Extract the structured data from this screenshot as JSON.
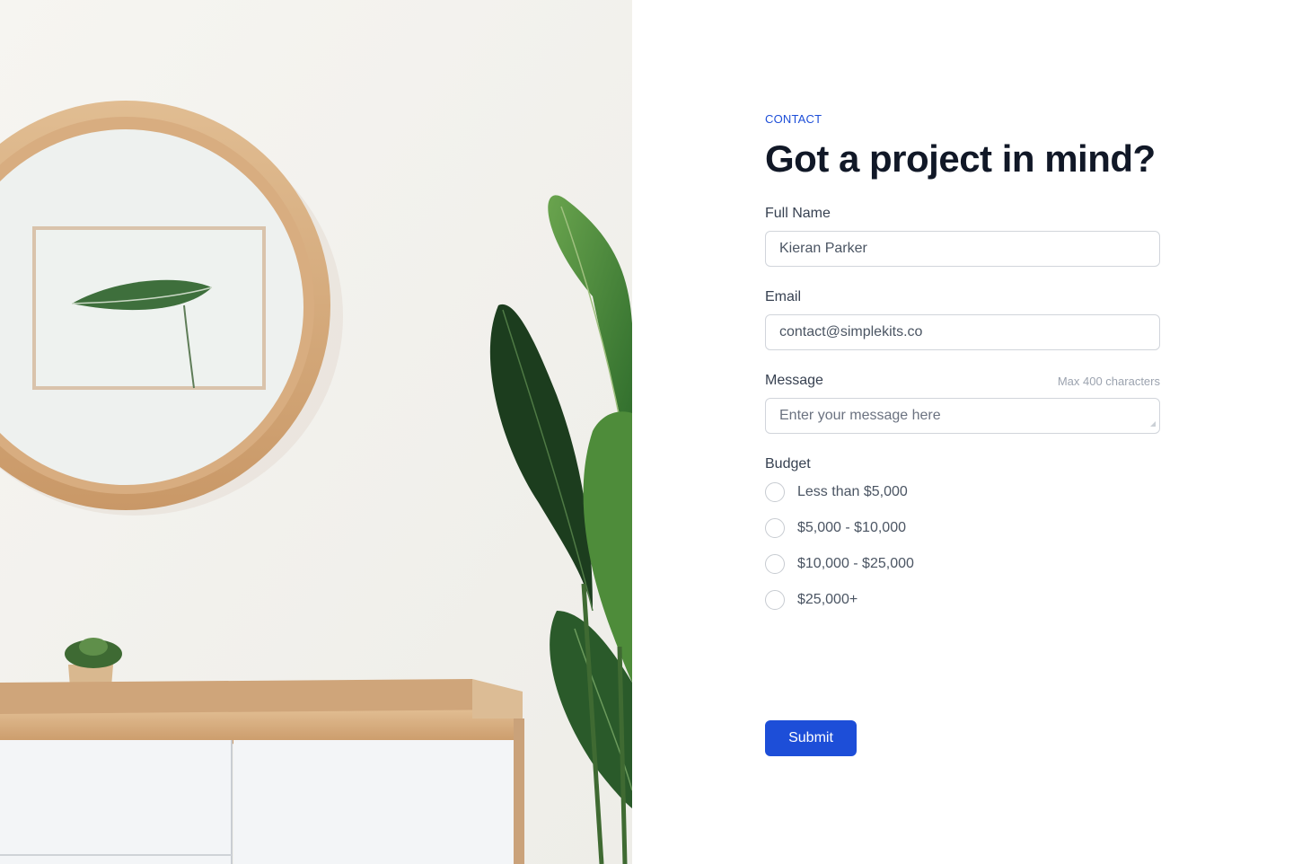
{
  "hero_image": {
    "subject": "interior-photo",
    "colors": {
      "wall": "#f3f2ee",
      "wood": "#d7ae83",
      "leaf": "#2f6b2e",
      "cabinet": "#f4f6f8"
    }
  },
  "form": {
    "eyebrow": "CONTACT",
    "title": "Got a project in mind?",
    "full_name": {
      "label": "Full Name",
      "value": "Kieran Parker"
    },
    "email": {
      "label": "Email",
      "value": "contact@simplekits.co"
    },
    "message": {
      "label": "Message",
      "hint": "Max 400 characters",
      "placeholder": "Enter your message here",
      "value": ""
    },
    "budget": {
      "label": "Budget",
      "options": [
        "Less than $5,000",
        "$5,000 - $10,000",
        "$10,000 - $25,000",
        "$25,000+"
      ]
    },
    "submit_label": "Submit"
  },
  "colors": {
    "accent": "#1d4ed8",
    "title": "#111827",
    "border": "#d1d5db",
    "muted": "#9ca3af"
  }
}
